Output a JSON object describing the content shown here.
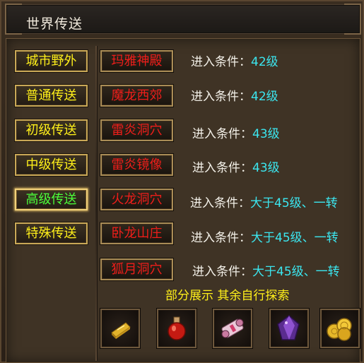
{
  "window": {
    "title": "世界传送"
  },
  "categories": [
    {
      "label": "城市野外",
      "active": false
    },
    {
      "label": "普通传送",
      "active": false
    },
    {
      "label": "初级传送",
      "active": false
    },
    {
      "label": "中级传送",
      "active": false
    },
    {
      "label": "高级传送",
      "active": true
    },
    {
      "label": "特殊传送",
      "active": false
    }
  ],
  "destinations": [
    {
      "name": "玛雅神殿",
      "cond_label": "进入条件：",
      "cond_value": "42级"
    },
    {
      "name": "魔龙西郊",
      "cond_label": "进入条件：",
      "cond_value": "42级"
    },
    {
      "name": "雷炎洞穴",
      "cond_label": "进入条件：",
      "cond_value": "43级"
    },
    {
      "name": "雷炎镜像",
      "cond_label": "进入条件：",
      "cond_value": "43级"
    },
    {
      "name": "火龙洞穴",
      "cond_label": "进入条件：",
      "cond_value": "大于45级、一转"
    },
    {
      "name": "卧龙山庄",
      "cond_label": "进入条件：",
      "cond_value": "大于45级、一转"
    },
    {
      "name": "狐月洞穴",
      "cond_label": "进入条件：",
      "cond_value": "大于45级、一转"
    }
  ],
  "note": "部分展示 其余自行探索",
  "rewards": [
    {
      "icon": "gold-bar-icon"
    },
    {
      "icon": "red-potion-icon"
    },
    {
      "icon": "scroll-icon"
    },
    {
      "icon": "purple-gem-icon"
    },
    {
      "icon": "gold-coins-icon"
    }
  ],
  "colors": {
    "category_text": "#fff01a",
    "active_category_text": "#4cff3a",
    "destination_text": "#ee1e1a",
    "condition_label": "#f3f0e8",
    "condition_value": "#3be6ef"
  }
}
